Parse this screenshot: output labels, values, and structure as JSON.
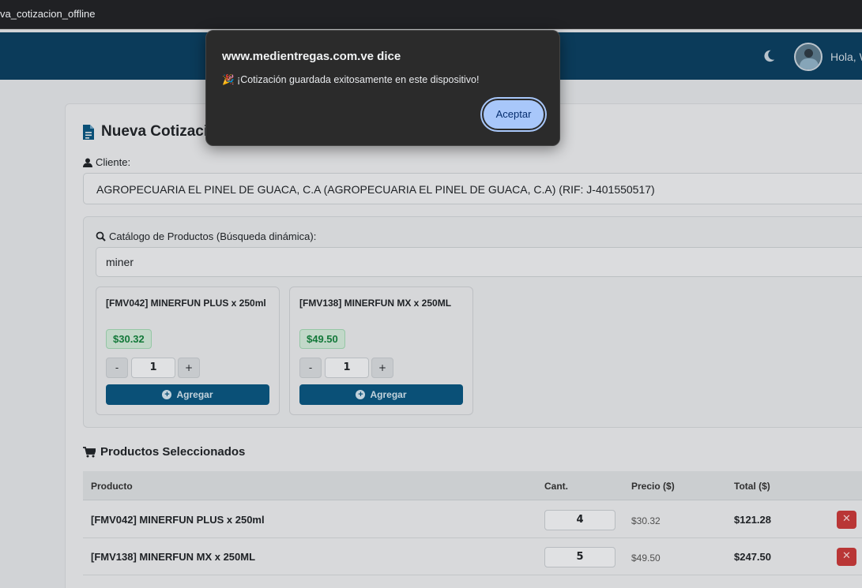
{
  "browser": {
    "tab_url": "va_cotizacion_offline"
  },
  "header": {
    "greeting": "Hola, W",
    "theme_icon": "moon-icon",
    "avatar_icon": "user-avatar"
  },
  "page": {
    "title": "Nueva Cotización",
    "client_label": "Cliente:",
    "client_value": "AGROPECUARIA EL PINEL DE GUACA, C.A (AGROPECUARIA EL PINEL DE GUACA, C.A) (RIF: J-401550517)",
    "catalog_label": "Catálogo de Productos (Búsqueda dinámica):",
    "search_value": "miner"
  },
  "catalog_items": [
    {
      "name": "[FMV042] MINERFUN PLUS x 250ml",
      "price": "$30.32",
      "qty": "1",
      "minus": "-",
      "plus": "+",
      "add_label": "Agregar"
    },
    {
      "name": "[FMV138] MINERFUN MX x 250ML",
      "price": "$49.50",
      "qty": "1",
      "minus": "-",
      "plus": "+",
      "add_label": "Agregar"
    }
  ],
  "selected": {
    "title": "Productos Seleccionados",
    "headers": {
      "product": "Producto",
      "qty": "Cant.",
      "price": "Precio ($)",
      "total": "Total ($)"
    },
    "rows": [
      {
        "product": "[FMV042] MINERFUN PLUS x 250ml",
        "qty": "4",
        "price": "$30.32",
        "total": "$121.28",
        "delete": "✕"
      },
      {
        "product": "[FMV138] MINERFUN MX x 250ML",
        "qty": "5",
        "price": "$49.50",
        "total": "$247.50",
        "delete": "✕"
      }
    ]
  },
  "dialog": {
    "title": "www.medientregas.com.ve dice",
    "message": "🎉 ¡Cotización guardada exitosamente en este dispositivo!",
    "ok_label": "Aceptar"
  },
  "colors": {
    "header": "#0c3f60",
    "primary_button": "#0b567f",
    "price_green": "#15803d",
    "danger": "#c53a3a",
    "dialog_button": "#a8c7fa"
  }
}
